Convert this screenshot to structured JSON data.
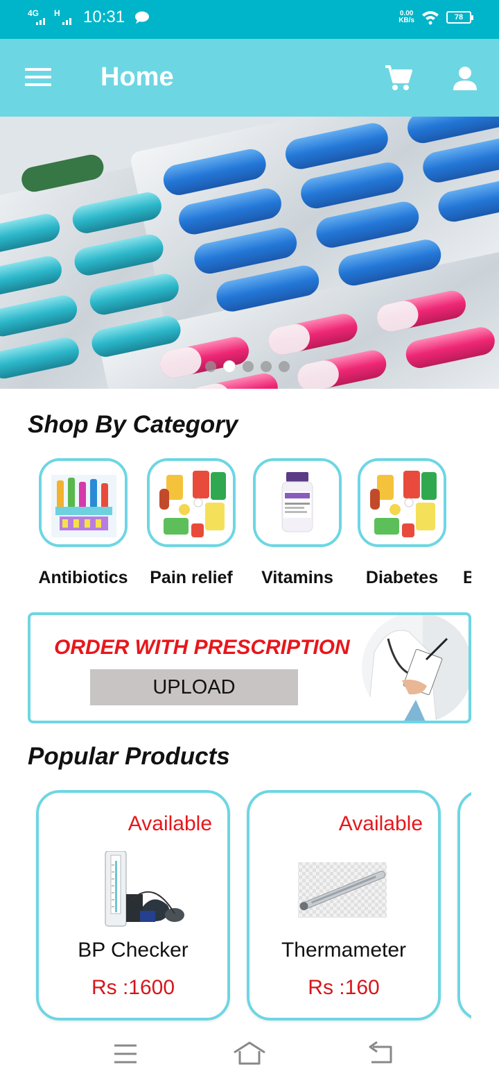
{
  "status_bar": {
    "network_1": "4G",
    "network_2": "H",
    "time": "10:31",
    "speed_value": "0.00",
    "speed_unit": "KB/s",
    "battery": "78"
  },
  "app_bar": {
    "title": "Home",
    "icons": [
      "menu-icon",
      "cart-icon",
      "profile-icon"
    ]
  },
  "banner": {
    "slide_count": 5,
    "active_slide": 2
  },
  "categories_section": {
    "title": "Shop By Category",
    "items": [
      {
        "label": "Antibiotics"
      },
      {
        "label": "Pain relief"
      },
      {
        "label": "Vitamins"
      },
      {
        "label": "Diabetes"
      },
      {
        "label": "B"
      }
    ]
  },
  "prescription": {
    "title": "ORDER WITH PRESCRIPTION",
    "button": "UPLOAD"
  },
  "products_section": {
    "title": "Popular Products",
    "items": [
      {
        "status": "Available",
        "name": "BP Checker",
        "price": "Rs :1600"
      },
      {
        "status": "Available",
        "name": "Thermameter",
        "price": "Rs :160"
      }
    ]
  },
  "colors": {
    "status_bar": "#00b5c9",
    "app_bar": "#6dd6e3",
    "accent_border": "#6dd6e3",
    "alert_red": "#e8161b"
  },
  "bottom_nav": {
    "icons": [
      "recents-icon",
      "home-icon",
      "back-icon"
    ]
  }
}
